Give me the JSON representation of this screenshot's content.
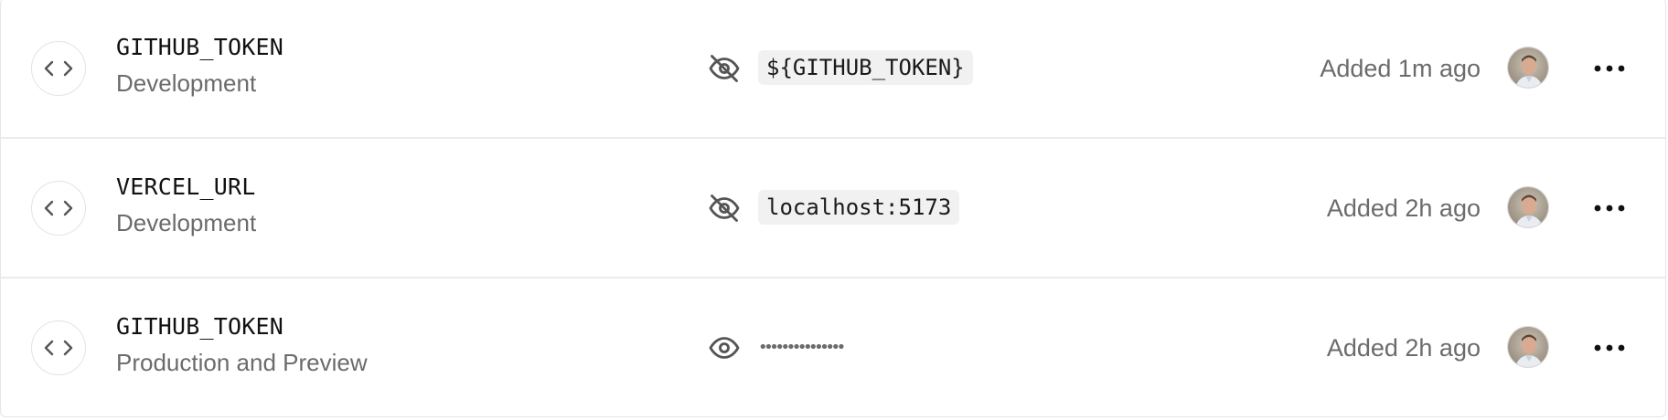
{
  "rows": [
    {
      "name": "GITHUB_TOKEN",
      "environment": "Development",
      "visibility_icon": "eye-off-icon",
      "value": "${GITHUB_TOKEN}",
      "added": "Added 1m ago"
    },
    {
      "name": "VERCEL_URL",
      "environment": "Development",
      "visibility_icon": "eye-off-icon",
      "value": "localhost:5173",
      "added": "Added 2h ago"
    },
    {
      "name": "GITHUB_TOKEN",
      "environment": "Production and Preview",
      "visibility_icon": "eye-icon",
      "masked_value": "•••••••••••••••",
      "added": "Added 2h ago"
    }
  ],
  "icons": {
    "row_icon": "code-icon",
    "menu": "more-horizontal-icon",
    "avatar": "user-avatar"
  },
  "colors": {
    "text_primary": "#111111",
    "text_secondary": "#6b6b6b",
    "border": "#e6e6e6",
    "chip_background": "#f1f1f1"
  }
}
